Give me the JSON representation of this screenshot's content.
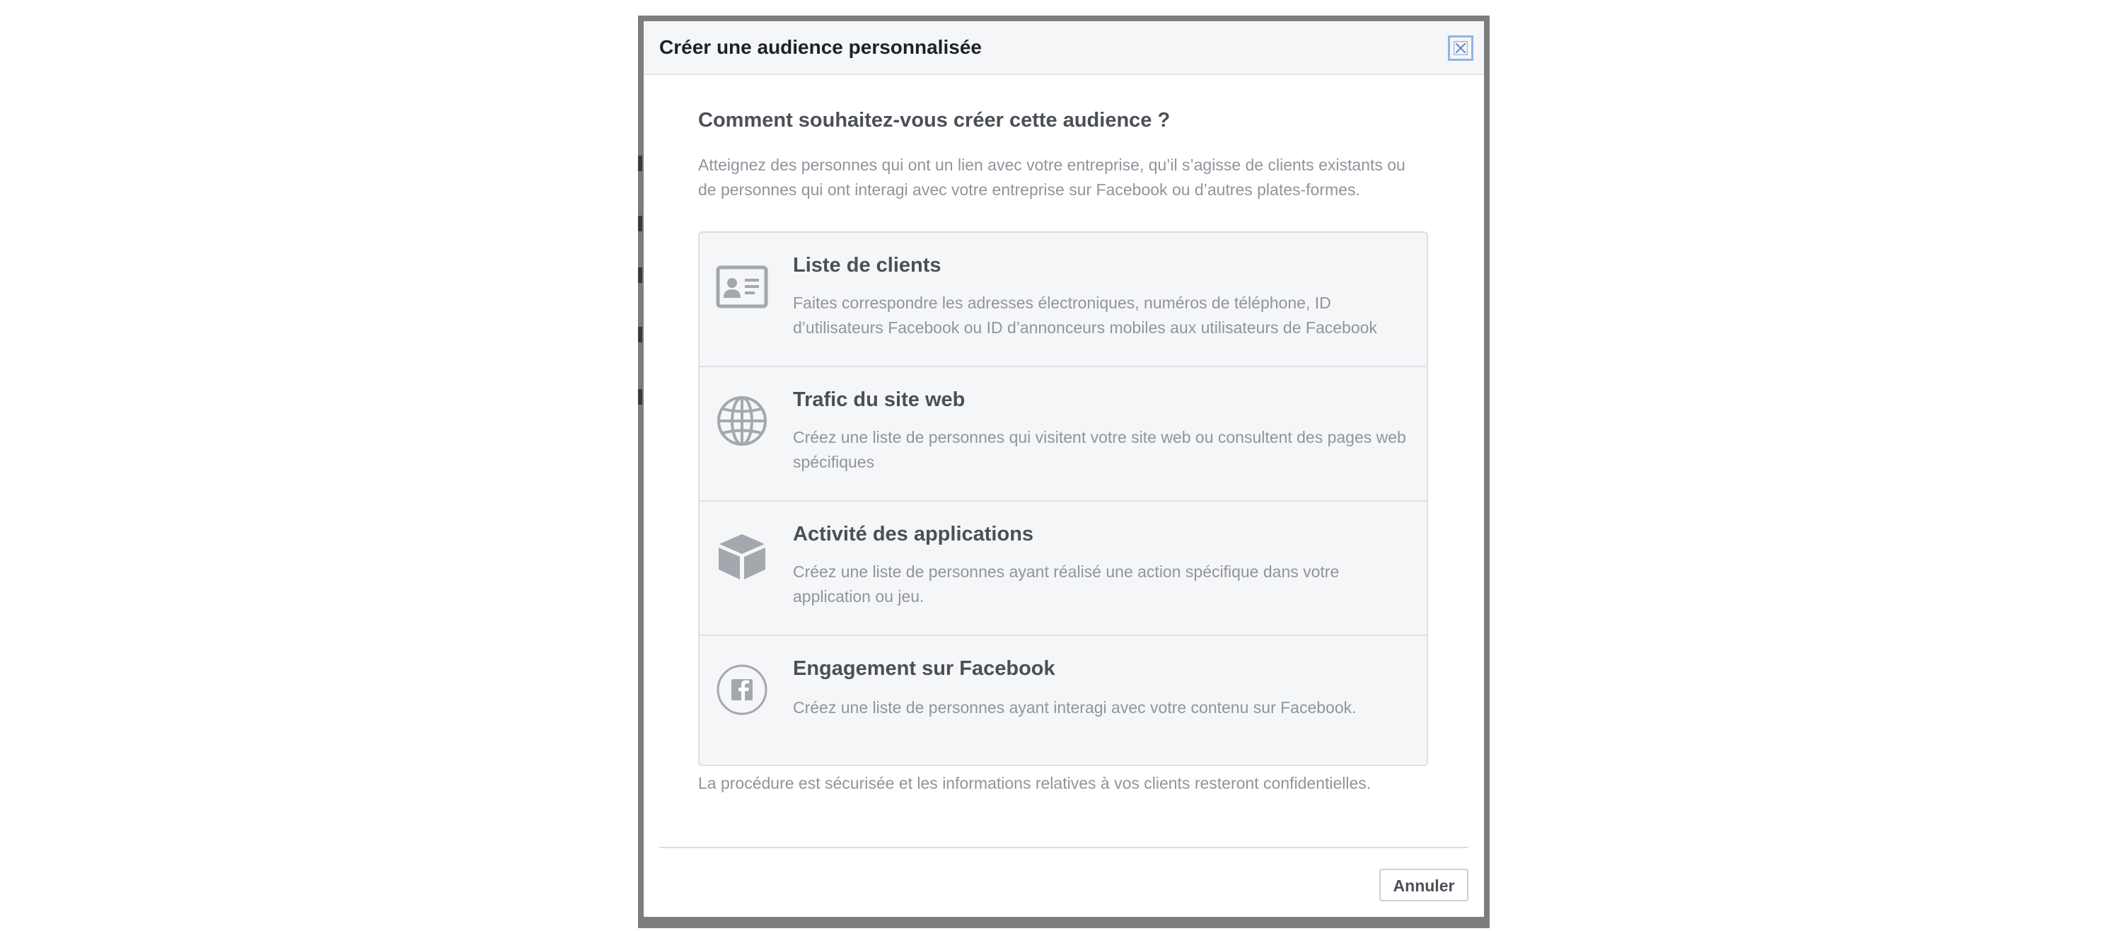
{
  "dialog": {
    "title": "Créer une audience personnalisée",
    "close_icon": "close-icon"
  },
  "question": "Comment souhaitez-vous créer cette audience ?",
  "intro": "Atteignez des personnes qui ont un lien avec votre entreprise, qu’il s’agisse de clients existants ou de personnes qui ont interagi avec votre entreprise sur Facebook ou d’autres plates-formes.",
  "options": [
    {
      "icon": "contact-card-icon",
      "title": "Liste de clients",
      "description": "Faites correspondre les adresses électroniques, numéros de téléphone, ID d’utilisateurs Facebook ou ID d’annonceurs mobiles aux utilisateurs de Facebook"
    },
    {
      "icon": "globe-icon",
      "title": "Trafic du site web",
      "description": "Créez une liste de personnes qui visitent votre site web ou consultent des pages web spécifiques"
    },
    {
      "icon": "cube-icon",
      "title": "Activité des applications",
      "description": "Créez une liste de personnes ayant réalisé une action spécifique dans votre application ou jeu."
    },
    {
      "icon": "facebook-icon",
      "title": "Engagement sur Facebook",
      "description": "Créez une liste de personnes ayant interagi avec votre contenu sur Facebook."
    }
  ],
  "footer_note": "La procédure est sécurisée et les informations relatives à vos clients resteront confidentielles.",
  "cancel_label": "Annuler",
  "colors": {
    "backdrop": "#7d7d7d",
    "header_bg": "#f5f6f7",
    "text_dark": "#1d2129",
    "text_medium": "#4b4f56",
    "text_muted": "#90949c",
    "icon_gray": "#a4a7ad",
    "close_border": "#8fb3e6"
  }
}
